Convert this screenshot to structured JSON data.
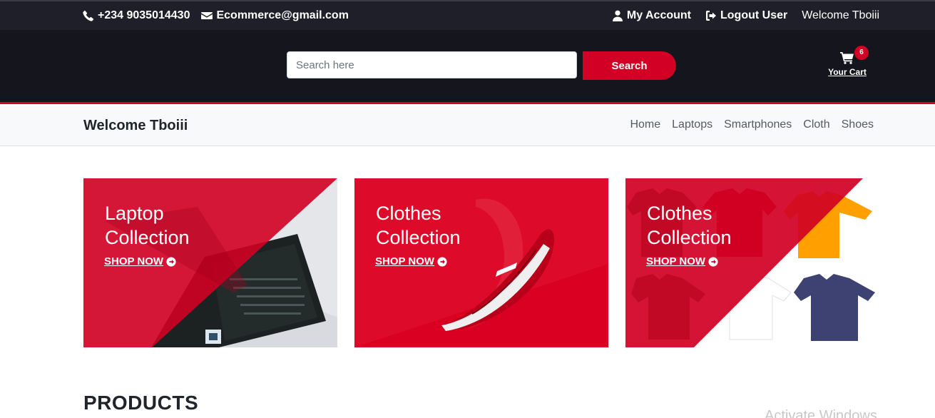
{
  "topbar": {
    "phone": "+234 9035014430",
    "email": "Ecommerce@gmail.com",
    "account": "My Account",
    "logout": "Logout User",
    "welcome": "Welcome Tboiii"
  },
  "header": {
    "search_placeholder": "Search here",
    "search_button": "Search",
    "cart_label": "Your Cart",
    "cart_count": "6"
  },
  "navbar": {
    "brand": "Welcome Tboiii",
    "links": [
      "Home",
      "Laptops",
      "Smartphones",
      "Cloth",
      "Shoes"
    ]
  },
  "collections": [
    {
      "title_line1": "Laptop",
      "title_line2": "Collection",
      "link": "SHOP NOW"
    },
    {
      "title_line1": "Clothes",
      "title_line2": "Collection",
      "link": "SHOP NOW"
    },
    {
      "title_line1": "Clothes",
      "title_line2": "Collection",
      "link": "SHOP NOW"
    }
  ],
  "section_title": "PRODUCTS",
  "watermark": "Activate Windows",
  "colors": {
    "accent": "#d10024",
    "topbar_bg": "#1e1f29",
    "header_bg": "#15161d",
    "navbar_bg": "#f8f9fa"
  }
}
